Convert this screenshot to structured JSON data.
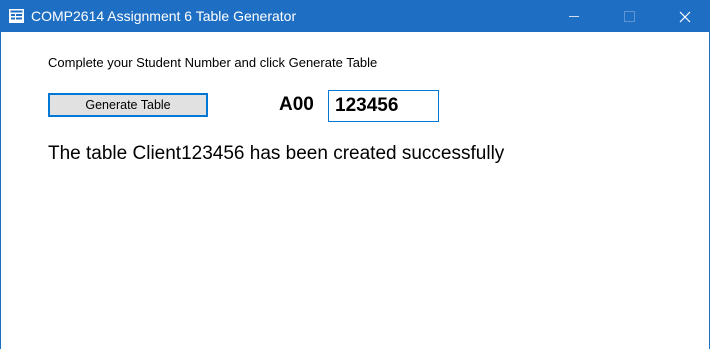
{
  "window": {
    "title": "COMP2614 Assignment 6 Table  Generator",
    "titlebar_color": "#1e6fc3",
    "controls": {
      "minimize_icon": "minimize-icon",
      "maximize_icon": "maximize-icon",
      "close_icon": "close-icon"
    }
  },
  "form": {
    "instruction": "Complete your Student Number and click Generate Table",
    "generate_button_label": "Generate Table",
    "student_prefix": "A00",
    "student_number_value": "123456",
    "status_message": "The table Client123456 has been created successfully"
  }
}
